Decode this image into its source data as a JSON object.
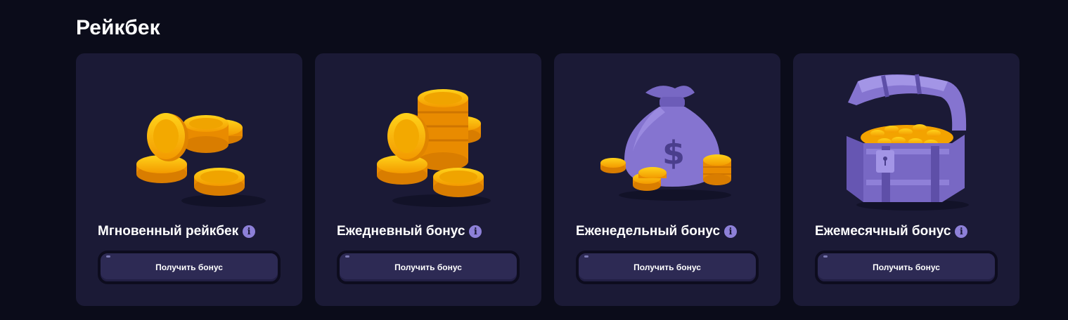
{
  "section": {
    "title": "Рейкбек"
  },
  "cards": [
    {
      "title": "Мгновенный рейкбек",
      "button_label": "Получить бонус",
      "icon": "coin-stack-icon"
    },
    {
      "title": "Ежедневный бонус",
      "button_label": "Получить бонус",
      "icon": "coin-tower-icon"
    },
    {
      "title": "Еженедельный бонус",
      "button_label": "Получить бонус",
      "icon": "money-bag-icon"
    },
    {
      "title": "Ежемесячный бонус",
      "button_label": "Получить бонус",
      "icon": "treasure-chest-icon"
    }
  ],
  "colors": {
    "background": "#0b0c1a",
    "card": "#1b1a36",
    "button": "#2d2a54",
    "info_icon": "#8d80d8",
    "gold": "#f5a300",
    "purple_item": "#8574d0"
  }
}
